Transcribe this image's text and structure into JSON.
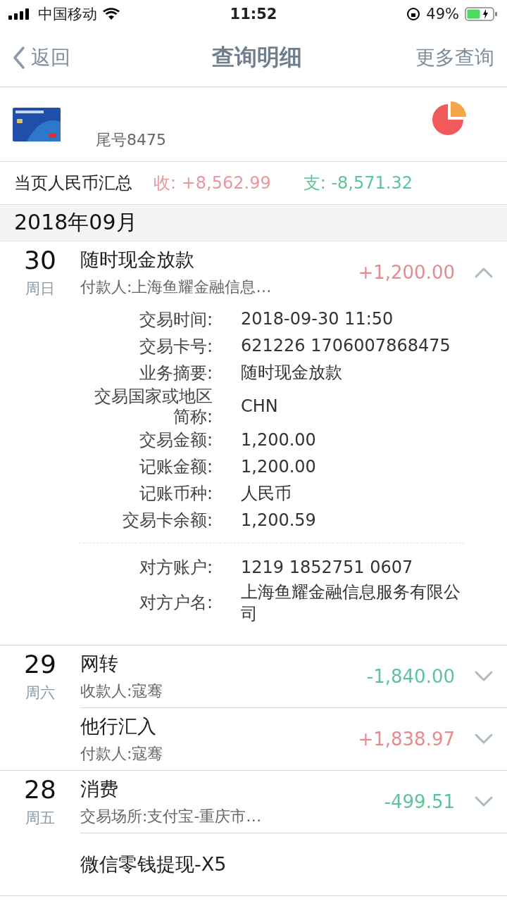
{
  "status_bar": {
    "carrier": "中国移动",
    "time": "11:52",
    "battery": "49%"
  },
  "nav": {
    "back": "返回",
    "title": "查询明细",
    "action": "更多查询"
  },
  "account": {
    "tail": "尾号8475"
  },
  "summary": {
    "label": "当页人民币汇总",
    "income": "收: +8,562.99",
    "expense": "支: -8,571.32"
  },
  "month": "2018年09月",
  "days": [
    {
      "day": "30",
      "weekday": "周日",
      "entries": [
        {
          "title": "随时现金放款",
          "subtitle": "付款人:上海鱼耀金融信息…",
          "amount": "+1,200.00",
          "kind": "income",
          "expanded": true,
          "details": [
            [
              {
                "label": "交易时间:",
                "value": "2018-09-30 11:50"
              },
              {
                "label": "交易卡号:",
                "value": "621226 1706007868475"
              },
              {
                "label": "业务摘要:",
                "value": "随时现金放款"
              },
              {
                "label": "交易国家或地区简称:",
                "value": "CHN"
              },
              {
                "label": "交易金额:",
                "value": "1,200.00"
              },
              {
                "label": "记账金额:",
                "value": "1,200.00"
              },
              {
                "label": "记账币种:",
                "value": "人民币"
              },
              {
                "label": "交易卡余额:",
                "value": "1,200.59"
              }
            ],
            [
              {
                "label": "对方账户:",
                "value": "1219 1852751 0607"
              },
              {
                "label": "对方户名:",
                "value": "上海鱼耀金融信息服务有限公司"
              }
            ]
          ]
        }
      ]
    },
    {
      "day": "29",
      "weekday": "周六",
      "entries": [
        {
          "title": "网转",
          "subtitle": "收款人:寇骞",
          "amount": "-1,840.00",
          "kind": "expense",
          "expanded": false
        },
        {
          "title": "他行汇入",
          "subtitle": "付款人:寇骞",
          "amount": "+1,838.97",
          "kind": "income",
          "expanded": false
        }
      ]
    },
    {
      "day": "28",
      "weekday": "周五",
      "entries": [
        {
          "title": "消费",
          "subtitle": "交易场所:支付宝-重庆市…",
          "amount": "-499.51",
          "kind": "expense",
          "expanded": false
        },
        {
          "title": "微信零钱提现-X5"
        }
      ]
    }
  ]
}
